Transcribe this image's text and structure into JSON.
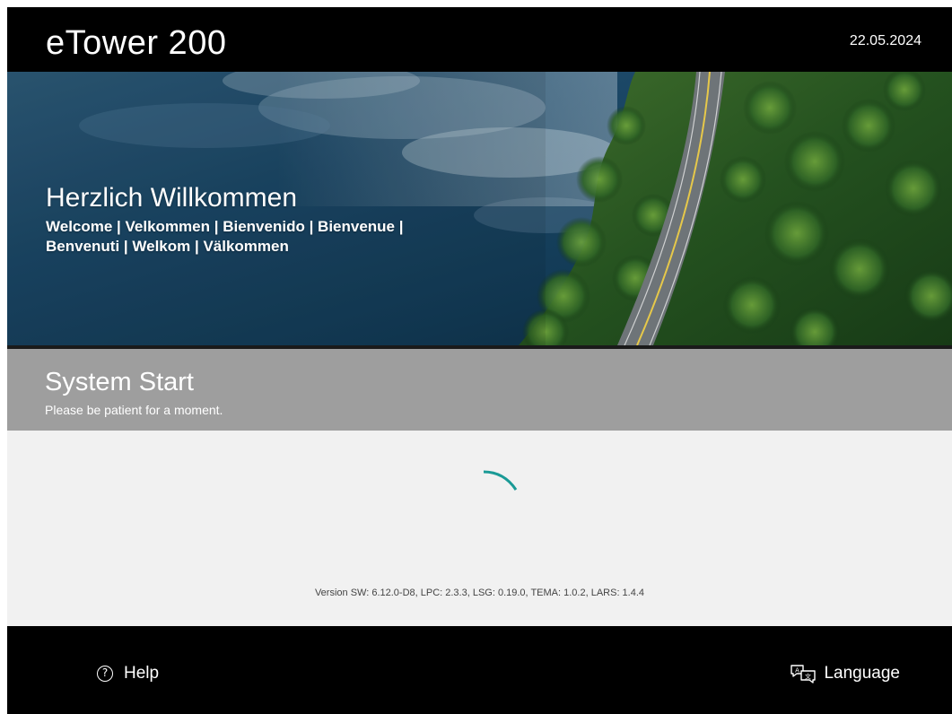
{
  "header": {
    "app_title": "eTower 200",
    "date": "22.05.2024"
  },
  "banner": {
    "welcome_title": "Herzlich Willkommen",
    "welcome_subtitle": "Welcome | Velkommen | Bienvenido | Bienvenue | Benvenuti | Welkom | Välkommen"
  },
  "status": {
    "title": "System Start",
    "subtitle": "Please be patient for a moment.",
    "accent_color": "#1a9a96"
  },
  "content": {
    "version_info": "Version SW: 6.12.0-D8, LPC: 2.3.3, LSG: 0.19.0, TEMA: 1.0.2, LARS: 1.4.4"
  },
  "footer": {
    "help_label": "Help",
    "help_icon": "question-circle-icon",
    "language_label": "Language",
    "language_icon": "translate-icon"
  }
}
